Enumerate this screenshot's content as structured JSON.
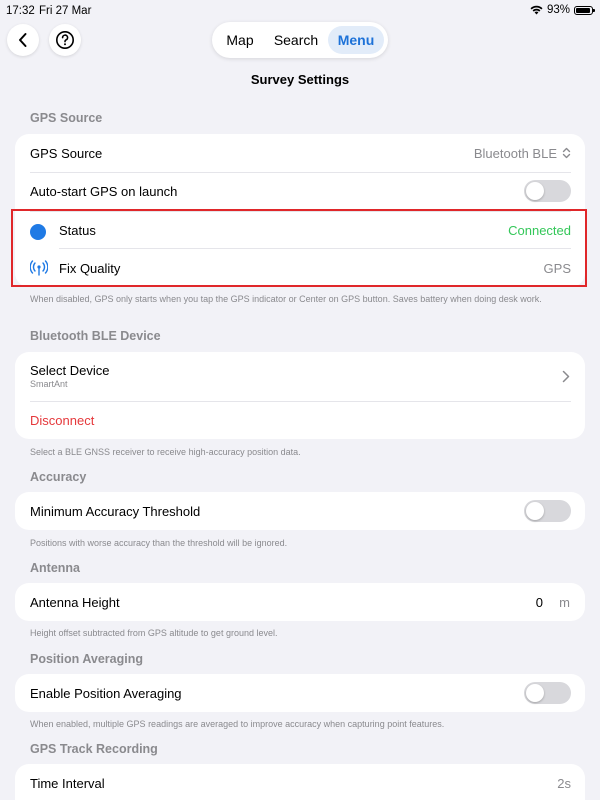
{
  "status_bar": {
    "time": "17:32",
    "date": "Fri 27 Mar",
    "battery": "93%"
  },
  "nav": {
    "back_icon": "chevron-left-icon",
    "help_icon": "question-circle-icon",
    "tabs": [
      {
        "label": "Map",
        "selected": false
      },
      {
        "label": "Search",
        "selected": false
      },
      {
        "label": "Menu",
        "selected": true
      }
    ]
  },
  "page_title": "Survey Settings",
  "accent_color": "#1d72d8",
  "gps_source": {
    "header": "GPS Source",
    "source_label": "GPS Source",
    "source_value": "Bluetooth BLE",
    "autostart_label": "Auto-start GPS on launch",
    "autostart_on": false,
    "status_label": "Status",
    "status_value": "Connected",
    "status_color": "#34c759",
    "fix_label": "Fix Quality",
    "fix_value": "GPS",
    "footnote": "When disabled, GPS only starts when you tap the GPS indicator or Center on GPS button. Saves battery when doing desk work."
  },
  "ble": {
    "header": "Bluetooth BLE Device",
    "select_label": "Select Device",
    "select_sub": "SmartAnt",
    "disconnect_label": "Disconnect",
    "footnote": "Select a BLE GNSS receiver to receive high-accuracy position data."
  },
  "accuracy": {
    "header": "Accuracy",
    "threshold_label": "Minimum Accuracy Threshold",
    "threshold_on": false,
    "footnote": "Positions with worse accuracy than the threshold will be ignored."
  },
  "antenna": {
    "header": "Antenna",
    "height_label": "Antenna Height",
    "height_value": "0",
    "height_unit": "m",
    "footnote": "Height offset subtracted from GPS altitude to get ground level."
  },
  "averaging": {
    "header": "Position Averaging",
    "enable_label": "Enable Position Averaging",
    "enable_on": false,
    "footnote": "When enabled, multiple GPS readings are averaged to improve accuracy when capturing point features."
  },
  "track": {
    "header": "GPS Track Recording",
    "interval_label": "Time Interval",
    "interval_value": "2s"
  }
}
